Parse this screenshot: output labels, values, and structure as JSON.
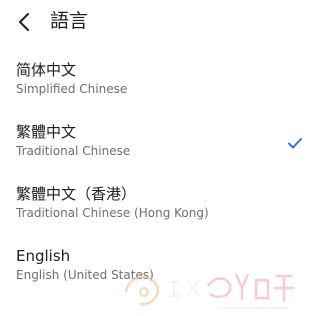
{
  "header": {
    "title": "語言"
  },
  "languages": [
    {
      "name": "简体中文",
      "subtitle": "Simplified Chinese",
      "selected": false
    },
    {
      "name": "繁體中文",
      "subtitle": "Traditional Chinese",
      "selected": true
    },
    {
      "name": "繁體中文（香港）",
      "subtitle": "Traditional Chinese (Hong Kong)",
      "selected": false
    },
    {
      "name": "English",
      "subtitle": "English (United States)",
      "selected": false
    }
  ],
  "colors": {
    "accent": "#3a6fd8",
    "text_primary": "#202020",
    "text_secondary": "#6f6f6f"
  },
  "icons": {
    "back": "chevron-left-icon",
    "selected": "checkmark-icon"
  }
}
